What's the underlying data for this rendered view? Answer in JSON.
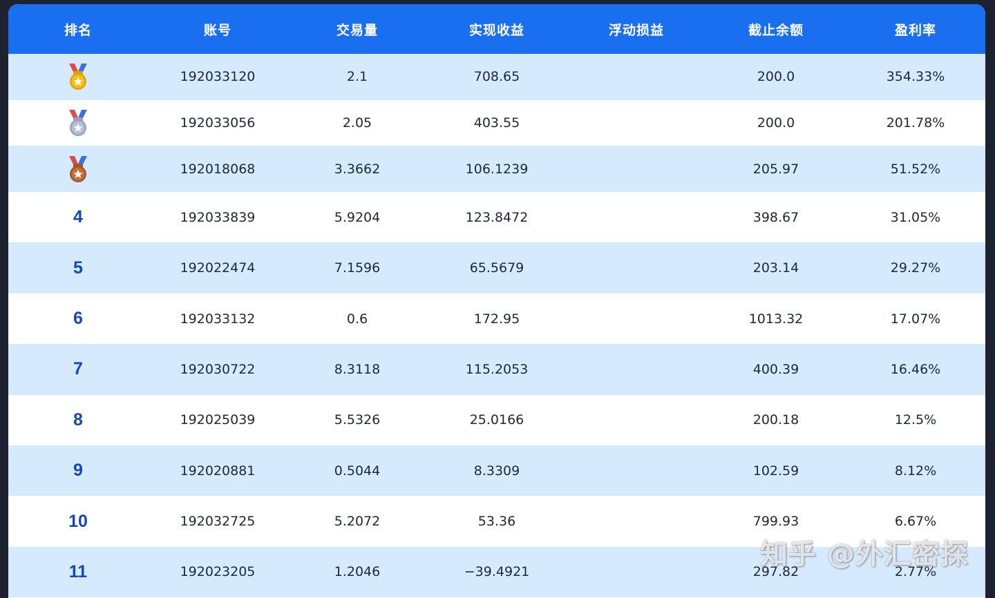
{
  "table": {
    "columns": [
      "排名",
      "账号",
      "交易量",
      "实现收益",
      "浮动损益",
      "截止余额",
      "盈利率"
    ],
    "rows": [
      {
        "rank": "",
        "medal": "gold-medal-icon",
        "account": "192033120",
        "volume": "2.1",
        "realized": "708.65",
        "floating": "",
        "balance": "200.0",
        "rate": "354.33%"
      },
      {
        "rank": "",
        "medal": "silver-medal-icon",
        "account": "192033056",
        "volume": "2.05",
        "realized": "403.55",
        "floating": "",
        "balance": "200.0",
        "rate": "201.78%"
      },
      {
        "rank": "",
        "medal": "bronze-medal-icon",
        "account": "192018068",
        "volume": "3.3662",
        "realized": "106.1239",
        "floating": "",
        "balance": "205.97",
        "rate": "51.52%"
      },
      {
        "rank": "4",
        "account": "192033839",
        "volume": "5.9204",
        "realized": "123.8472",
        "floating": "",
        "balance": "398.67",
        "rate": "31.05%"
      },
      {
        "rank": "5",
        "account": "192022474",
        "volume": "7.1596",
        "realized": "65.5679",
        "floating": "",
        "balance": "203.14",
        "rate": "29.27%"
      },
      {
        "rank": "6",
        "account": "192033132",
        "volume": "0.6",
        "realized": "172.95",
        "floating": "",
        "balance": "1013.32",
        "rate": "17.07%"
      },
      {
        "rank": "7",
        "account": "192030722",
        "volume": "8.3118",
        "realized": "115.2053",
        "floating": "",
        "balance": "400.39",
        "rate": "16.46%"
      },
      {
        "rank": "8",
        "account": "192025039",
        "volume": "5.5326",
        "realized": "25.0166",
        "floating": "",
        "balance": "200.18",
        "rate": "12.5%"
      },
      {
        "rank": "9",
        "account": "192020881",
        "volume": "0.5044",
        "realized": "8.3309",
        "floating": "",
        "balance": "102.59",
        "rate": "8.12%"
      },
      {
        "rank": "10",
        "account": "192032725",
        "volume": "5.2072",
        "realized": "53.36",
        "floating": "",
        "balance": "799.93",
        "rate": "6.67%"
      },
      {
        "rank": "11",
        "account": "192023205",
        "volume": "1.2046",
        "realized": "−39.4921",
        "floating": "",
        "balance": "297.82",
        "rate": "2.77%"
      }
    ]
  },
  "watermark": "知乎 @外汇密探",
  "colors": {
    "header_bg": "#1a6ff0",
    "row_alt_bg": "#d6eafe",
    "rank_text": "#1448b8",
    "gold": "#f2c21b",
    "silver": "#b9bfd3",
    "bronze": "#c0703a"
  }
}
